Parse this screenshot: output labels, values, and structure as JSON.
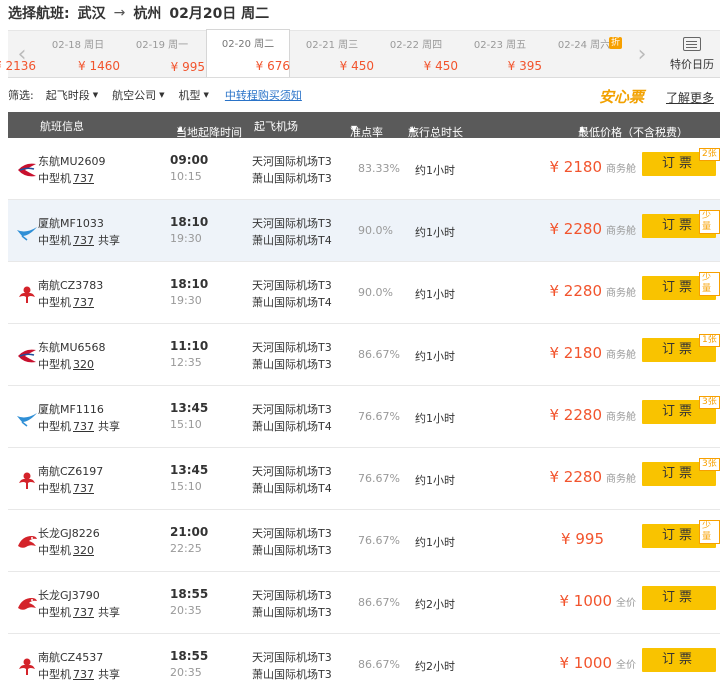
{
  "header": {
    "label": "选择航班:",
    "from": "武汉",
    "arrow": "→",
    "to": "杭州",
    "date": "02月20日 周二"
  },
  "date_strip": {
    "cells": [
      {
        "price": "¥ 2136",
        "date": "02-18 周日"
      },
      {
        "price": "¥ 1460",
        "date": "02-19 周一"
      },
      {
        "price": "¥ 995",
        "date": "02-20 周二"
      },
      {
        "price": "¥ 676",
        "date": "02-21 周三"
      },
      {
        "price": "¥ 450",
        "date": "02-22 周四"
      },
      {
        "price": "¥ 450",
        "date": "02-23 周五"
      },
      {
        "price": "¥ 395",
        "date": "02-24 周六",
        "badge": "折"
      }
    ],
    "special_calendar_label": "特价日历"
  },
  "filters": {
    "label": "筛选:",
    "buttons": [
      "起飞时段",
      "航空公司",
      "机型"
    ],
    "transfer_link": "中转程购买须知",
    "anxin": "安心票",
    "learn_more": "了解更多"
  },
  "table_header": {
    "flight_info": "航班信息",
    "local_time": "当地起降时间",
    "airport": "起Airport",
    "ontime": "准点率",
    "duration": "旅行总时长",
    "lowest_price": "最低价格（不含税费）"
  },
  "flights": [
    {
      "airline": "东航MU2609",
      "size": "中型机",
      "model": "737",
      "share": "",
      "dep_time": "09:00",
      "arr_time": "10:15",
      "dep_airport": "天河国际机场T3",
      "arr_airport": "萧山国际机场T3",
      "ontime": "83.33%",
      "duration": "约1小时",
      "price": "¥ 2180",
      "cabin": "商务舱",
      "book": "订票",
      "tag": "2张",
      "logo": "china-eastern"
    },
    {
      "airline": "厦航MF1033",
      "size": "中型机",
      "model": "737",
      "share": "共享",
      "dep_time": "18:10",
      "arr_time": "19:30",
      "dep_airport": "天河国际机场T3",
      "arr_airport": "萧山国际机场T4",
      "ontime": "90.0%",
      "duration": "约1小时",
      "price": "¥ 2280",
      "cabin": "商务舱",
      "book": "订票",
      "tag": "少量",
      "logo": "xiamen-air"
    },
    {
      "airline": "南航CZ3783",
      "size": "中型机",
      "model": "737",
      "share": "",
      "dep_time": "18:10",
      "arr_time": "19:30",
      "dep_airport": "天河国际机场T3",
      "arr_airport": "萧山国际机场T4",
      "ontime": "90.0%",
      "duration": "约1小时",
      "price": "¥ 2280",
      "cabin": "商务舱",
      "book": "订票",
      "tag": "少量",
      "logo": "china-southern"
    },
    {
      "airline": "东航MU6568",
      "size": "中型机",
      "model": "320",
      "share": "",
      "dep_time": "11:10",
      "arr_time": "12:35",
      "dep_airport": "天河国际机场T3",
      "arr_airport": "萧山国际机场T3",
      "ontime": "86.67%",
      "duration": "约1小时",
      "price": "¥ 2180",
      "cabin": "商务舱",
      "book": "订票",
      "tag": "1张",
      "logo": "china-eastern"
    },
    {
      "airline": "厦航MF1116",
      "size": "中型机",
      "model": "737",
      "share": "共享",
      "dep_time": "13:45",
      "arr_time": "15:10",
      "dep_airport": "天河国际机场T3",
      "arr_airport": "萧山国际机场T4",
      "ontime": "76.67%",
      "duration": "约1小时",
      "price": "¥ 2280",
      "cabin": "商务舱",
      "book": "订票",
      "tag": "3张",
      "logo": "xiamen-air"
    },
    {
      "airline": "南航CZ6197",
      "size": "中型机",
      "model": "737",
      "share": "",
      "dep_time": "13:45",
      "arr_time": "15:10",
      "dep_airport": "天河国际机场T3",
      "arr_airport": "萧山国际机场T4",
      "ontime": "76.67%",
      "duration": "约1小时",
      "price": "¥ 2280",
      "cabin": "商务舱",
      "book": "订票",
      "tag": "3张",
      "logo": "china-southern"
    },
    {
      "airline": "长龙GJ8226",
      "size": "中型机",
      "model": "320",
      "share": "",
      "dep_time": "21:00",
      "arr_time": "22:25",
      "dep_airport": "天河国际机场T3",
      "arr_airport": "萧山国际机场T3",
      "ontime": "76.67%",
      "duration": "约1小时",
      "price": "¥ 995",
      "cabin": "",
      "book": "订票",
      "tag": "少量",
      "logo": "loong-air"
    },
    {
      "airline": "长龙GJ3790",
      "size": "中型机",
      "model": "737",
      "share": "共享",
      "dep_time": "18:55",
      "arr_time": "20:35",
      "dep_airport": "天河国际机场T3",
      "arr_airport": "萧山国际机场T3",
      "ontime": "86.67%",
      "duration": "约2小时",
      "price": "¥ 1000",
      "cabin": "全价",
      "book": "订票",
      "tag": "",
      "logo": "loong-air"
    },
    {
      "airline": "南航CZ4537",
      "size": "中型机",
      "model": "737",
      "share": "共享",
      "dep_time": "18:55",
      "arr_time": "20:35",
      "dep_airport": "天河国际机场T3",
      "arr_airport": "萧山国际机场T3",
      "ontime": "86.67%",
      "duration": "约2小时",
      "price": "¥ 1000",
      "cabin": "全价",
      "book": "订票",
      "tag": "",
      "logo": "china-southern"
    }
  ],
  "colors": {
    "price": "#f2542d",
    "book_button": "#f9c300",
    "header_bg": "#5a5a5a",
    "highlight_row": "#eef3f9",
    "tag": "#f7a000"
  }
}
